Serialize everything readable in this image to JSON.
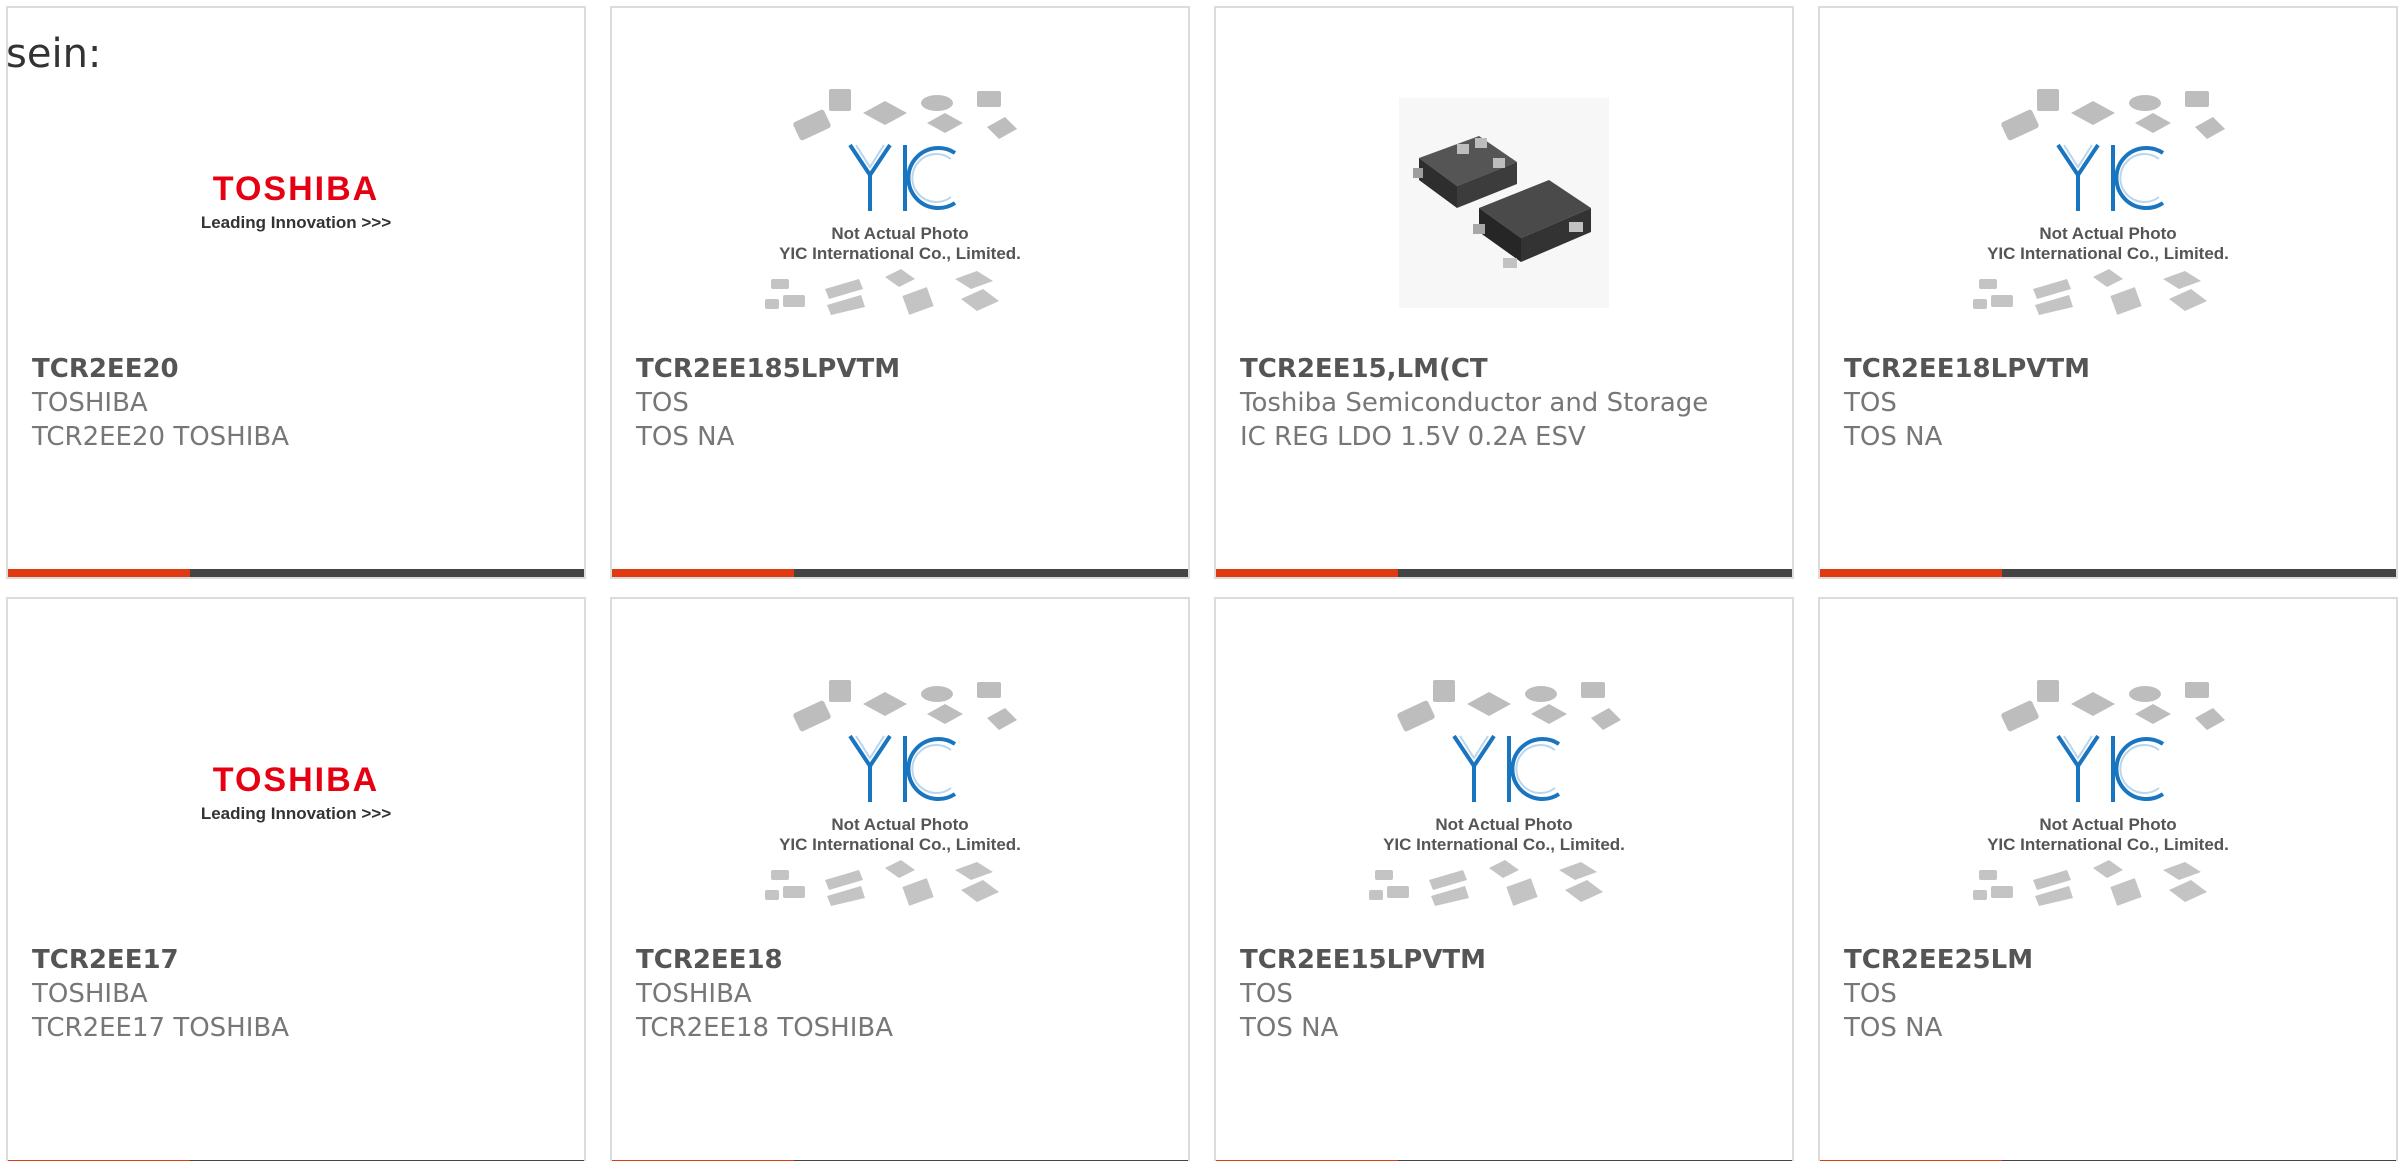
{
  "lead_text": "sein:",
  "placeholder": {
    "caption_line1": "Not Actual Photo",
    "caption_line2": "YIC International Co., Limited."
  },
  "brand_logo": {
    "name": "TOSHIBA",
    "tagline": "Leading Innovation >>>"
  },
  "colors": {
    "accent": "#e03a12",
    "bar": "#444444",
    "border": "#dcdcdc",
    "text": "#777777",
    "logo_red": "#e60012",
    "yic_blue": "#1a75c0"
  },
  "products": [
    {
      "part": "TCR2EE20",
      "maker": "TOSHIBA",
      "description": "TCR2EE20 TOSHIBA",
      "image": "toshiba-logo"
    },
    {
      "part": "TCR2EE185LPVTM",
      "maker": "TOS",
      "description": "TOS NA",
      "image": "yic-placeholder"
    },
    {
      "part": "TCR2EE15,LM(CT",
      "maker": "Toshiba Semiconductor and Storage",
      "description": "IC REG LDO 1.5V 0.2A ESV",
      "image": "chip-photo"
    },
    {
      "part": "TCR2EE18LPVTM",
      "maker": "TOS",
      "description": "TOS NA",
      "image": "yic-placeholder"
    },
    {
      "part": "TCR2EE17",
      "maker": "TOSHIBA",
      "description": "TCR2EE17 TOSHIBA",
      "image": "toshiba-logo"
    },
    {
      "part": "TCR2EE18",
      "maker": "TOSHIBA",
      "description": "TCR2EE18 TOSHIBA",
      "image": "yic-placeholder"
    },
    {
      "part": "TCR2EE15LPVTM",
      "maker": "TOS",
      "description": "TOS NA",
      "image": "yic-placeholder"
    },
    {
      "part": "TCR2EE25LM",
      "maker": "TOS",
      "description": "TOS NA",
      "image": "yic-placeholder"
    }
  ]
}
